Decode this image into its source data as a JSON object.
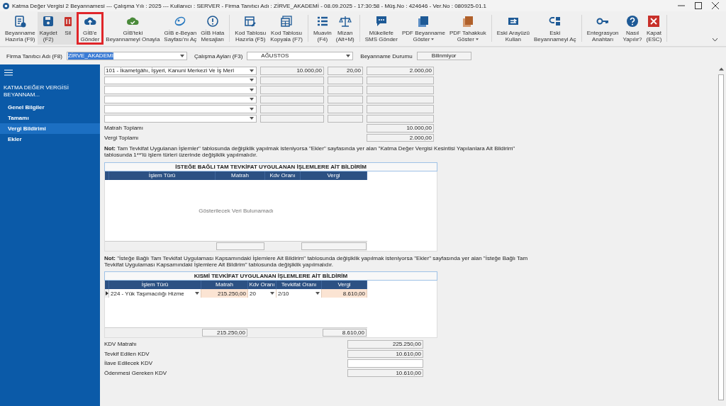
{
  "window": {
    "title": "Katma Değer Vergisi 2 Beyannamesi  ---  Çalışma Yılı : 2025  ---  Kullanıcı : SERVER - Firma Tanıtıcı Adı : ZİRVE_AKADEMİ - 08.09.2025 - 17:30:58 - Müş.No : 424646 - Ver.No : 080925-01.1"
  },
  "toolbar": {
    "groups": [
      [
        {
          "label": "Beyanname\nHazırla (F9)",
          "kind": "form",
          "shaded": false,
          "highlighted": false,
          "dropdown": false
        },
        {
          "label": "Kaydet\n(F2)",
          "kind": "save",
          "shaded": true,
          "highlighted": false,
          "dropdown": false
        },
        {
          "label": "Sil",
          "kind": "trash",
          "shaded": true,
          "highlighted": false,
          "dropdown": false
        },
        {
          "label": "GİB'e\nGönder",
          "kind": "upload",
          "shaded": false,
          "highlighted": true,
          "dropdown": false
        },
        {
          "label": "GİB'teki\nBeyannameyi Onayla",
          "kind": "cloudcheck",
          "shaded": false,
          "highlighted": false,
          "dropdown": false
        },
        {
          "label": "GİB e-Beyan\nSayfası'nı Aç",
          "kind": "globe",
          "shaded": false,
          "highlighted": false,
          "dropdown": false
        },
        {
          "label": "GİB Hata\nMesajları",
          "kind": "alert",
          "shaded": false,
          "highlighted": false,
          "dropdown": false
        }
      ],
      [
        {
          "label": "Kod Tablosu\nHazırla (F5)",
          "kind": "tableedit",
          "shaded": false,
          "highlighted": false,
          "dropdown": false
        },
        {
          "label": "Kod Tablosu\nKopyala (F7)",
          "kind": "table",
          "shaded": false,
          "highlighted": false,
          "dropdown": false
        }
      ],
      [
        {
          "label": "Muavin\n(F4)",
          "kind": "list",
          "shaded": false,
          "highlighted": false,
          "dropdown": false
        },
        {
          "label": "Mizan\n(Alt+M)",
          "kind": "scale",
          "shaded": false,
          "highlighted": false,
          "dropdown": false
        }
      ],
      [
        {
          "label": "Mükellefe\nSMS Gönder",
          "kind": "chat",
          "shaded": false,
          "highlighted": false,
          "dropdown": false
        },
        {
          "label": "PDF Beyanname\nGöster",
          "kind": "pdfblue",
          "shaded": false,
          "highlighted": false,
          "dropdown": true
        },
        {
          "label": "PDF Tahakkuk\nGöster",
          "kind": "pdforange",
          "shaded": false,
          "highlighted": false,
          "dropdown": true
        }
      ],
      [
        {
          "label": "Eski Arayüzü\nKullan",
          "kind": "swap",
          "shaded": false,
          "highlighted": false,
          "dropdown": false
        },
        {
          "label": "Eski\nBeyannameyi Aç",
          "kind": "switch",
          "shaded": false,
          "highlighted": false,
          "dropdown": false
        }
      ],
      [
        {
          "label": "Entegrasyon\nAnahtarı",
          "kind": "key",
          "shaded": false,
          "highlighted": false,
          "dropdown": false
        },
        {
          "label": "Nasıl\nYapılır?",
          "kind": "help",
          "shaded": false,
          "highlighted": false,
          "dropdown": false
        },
        {
          "label": "Kapat\n(ESC)",
          "kind": "close",
          "shaded": false,
          "highlighted": false,
          "dropdown": false
        }
      ]
    ]
  },
  "filters": {
    "firm": {
      "label": "Firma Tanıtıcı Adı (F8)",
      "value": "ZİRVE_AKADEMİ"
    },
    "month": {
      "label": "Çalışma Ayları (F3)",
      "value": "AĞUSTOS"
    },
    "status": {
      "label": "Beyanname Durumu",
      "value": "Bilinmiyor"
    }
  },
  "sidebar": {
    "title": "KATMA  DEĞER VERGİSİ BEYANNAM...",
    "items": [
      {
        "label": "Genel Bilgiler",
        "selected": false
      },
      {
        "label": "Tamamı",
        "selected": false
      },
      {
        "label": "Vergi Bildirimi",
        "selected": true
      },
      {
        "label": "Ekler",
        "selected": false
      }
    ]
  },
  "tax_rows": [
    {
      "type": "101 - İkametgâhı, İşyeri, Kanuni Merkezi Ve İş Merl",
      "base": "10.000,00",
      "rate": "20,00",
      "tax": "2.000,00"
    },
    {},
    {},
    {},
    {},
    {}
  ],
  "totals": [
    {
      "label": "Matrah Toplamı",
      "value": "10.000,00"
    },
    {
      "label": "Vergi Toplamı",
      "value": "2.000,00"
    }
  ],
  "note_1": "**Not:** Tam Tevkifat Uygulanan İşlemler\" tablosunda değişiklik yapılmak isteniyorsa \"Ekler\" sayfasında yer alan \"Katma Değer Vergisi Kesintisi Yapılanlara Ait Bildirim\" tablosunda 1**'lü işlem türleri üzerinde değişiklik yapılmalıdır.",
  "optional_table": {
    "title": "İSTEĞE BAĞLI TAM TEVKİFAT UYGULANAN İŞLEMLERE AİT BİLDİRİM",
    "columns": [
      "İşlem Türü",
      "Matrah",
      "Kdv Oranı",
      "Vergi"
    ],
    "empty_text": "Gösterilecek Veri Bulunamadı"
  },
  "note_2": "**Not:** \"İsteğe Bağlı Tam Tevkifat Uygulaması Kapsamındaki İşlemlere Ait Bildirim\" tablosunda değişiklik yapılmak isteniyorsa \"Ekler\" sayfasında yer alan \"İsteğe Bağlı Tam Tevkifat Uygulaması Kapsamındaki İşlemlere Ait Bildirim\" tablosunda değişiklik yapılmalıdır.",
  "partial_table": {
    "title": "KISMİ TEVKİFAT UYGULANAN İŞLEMLERE AİT BİLDİRİM",
    "columns": [
      "İşlem Türü",
      "Matrah",
      "Kdv Oranı",
      "Tevkifat Oranı",
      "Vergi"
    ],
    "rows": [
      {
        "current": true,
        "cells": [
          "224 - Yük Taşımacılığı Hizme",
          "215.250,00",
          "20",
          "2/10",
          "8.610,00"
        ]
      }
    ],
    "footer": {
      "base": "215.250,00",
      "tax": "8.610,00"
    }
  },
  "summary": [
    {
      "label": "KDV Matrahı",
      "kind": "readonly",
      "value": "225.250,00"
    },
    {
      "label": "Tevkif Edilen KDV",
      "kind": "readonly",
      "value": "10.610,00"
    },
    {
      "label": "İlave Edilecek KDV",
      "kind": "input"
    },
    {
      "label": "Ödenmesi Gereken KDV",
      "kind": "readonly",
      "value": "10.610,00"
    }
  ]
}
